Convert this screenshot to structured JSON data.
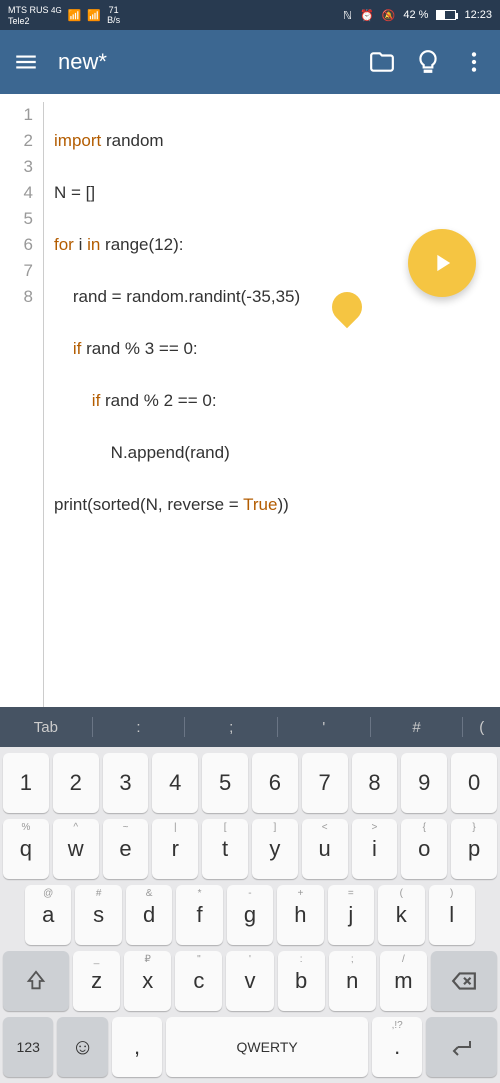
{
  "status_bar": {
    "carrier1": "MTS RUS",
    "carrier1_sub": "4G",
    "carrier2": "Tele2",
    "bps_top": "71",
    "bps_bot": "B/s",
    "battery_pct": "42 %",
    "time": "12:23"
  },
  "app_bar": {
    "title": "new*"
  },
  "code": {
    "lines": [
      "1",
      "2",
      "3",
      "4",
      "5",
      "6",
      "7",
      "8"
    ],
    "l1_kw1": "import",
    "l1_t1": " random",
    "l2_t1": "N = []",
    "l3_kw1": "for",
    "l3_t1": " i ",
    "l3_kw2": "in",
    "l3_t2": " range(12):",
    "l4_t1": "    rand = random.randint(-35,35)",
    "l5_t1": "    ",
    "l5_kw1": "if",
    "l5_t2": " rand % 3 == 0:",
    "l6_t1": "        ",
    "l6_kw1": "if",
    "l6_t2": " rand % 2 == 0:",
    "l7_t1": "            N.append(rand)",
    "l8_t1": "print(sorted(N, reverse = ",
    "l8_kw1": "True",
    "l8_t2": "))"
  },
  "shortcuts": {
    "s1": "Tab",
    "s2": ":",
    "s3": ";",
    "s4": "'",
    "s5": "#",
    "s6": "("
  },
  "keyboard": {
    "row1": [
      "1",
      "2",
      "3",
      "4",
      "5",
      "6",
      "7",
      "8",
      "9",
      "0"
    ],
    "row2_sup": [
      "%",
      "^",
      "~",
      "|",
      "[",
      "]",
      "<",
      ">",
      "{",
      "}"
    ],
    "row2": [
      "q",
      "w",
      "e",
      "r",
      "t",
      "y",
      "u",
      "i",
      "o",
      "p"
    ],
    "row3_sup": [
      "@",
      "#",
      "&",
      "*",
      "-",
      "+",
      "=",
      "(",
      ")"
    ],
    "row3": [
      "a",
      "s",
      "d",
      "f",
      "g",
      "h",
      "j",
      "k",
      "l"
    ],
    "row4_sup": [
      "_",
      "₽",
      "\"",
      "'",
      ":",
      ";",
      "/"
    ],
    "row4": [
      "z",
      "x",
      "c",
      "v",
      "b",
      "n",
      "m"
    ],
    "row5": {
      "mode": "123",
      "comma": ",",
      "space": "QWERTY",
      "period": ".",
      "period_sup": ",!?"
    }
  }
}
